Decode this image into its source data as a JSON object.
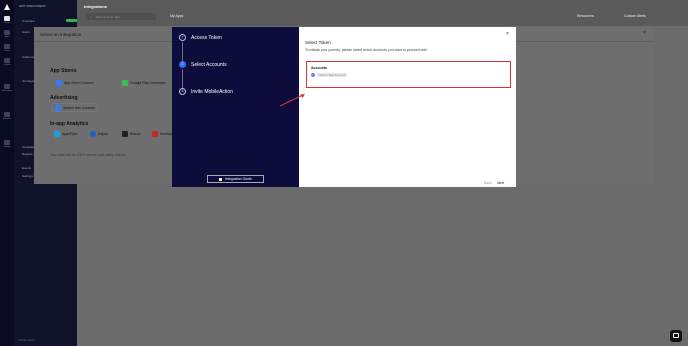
{
  "app_nav": {
    "labels": [
      "Home",
      "Apps",
      "Users",
      "Insights",
      "Messaging",
      "Analytics",
      "Settings"
    ]
  },
  "sub_nav": {
    "app_name": "APP DISCOVERY",
    "items": [
      "Overview",
      "Users",
      "Audience",
      "Journeys",
      "Campaigns",
      "Reports",
      "Events",
      "Settings"
    ],
    "footer": "MobileAction"
  },
  "topbar": {
    "title": "Integrations",
    "search_placeholder": "Search for an app",
    "my_apps": "My Apps",
    "resources": "Resources",
    "custom_alerts": "Custom Alerts"
  },
  "select_integration": {
    "title": "Select an Integration",
    "sections": {
      "app_stores": "App Stores",
      "advertising": "Advertising",
      "in_app_analytics": "In-app Analytics"
    },
    "app_store_connect": "App Store Connect",
    "google_play": "Google Play Developer",
    "search_ads_connect": "Search Ads Connect",
    "appsflyer": "AppsFlyer",
    "adjust": "Adjust",
    "branch": "Branch",
    "kochava": "Kochava",
    "safe_note": "Your data will be 100% secure and safely stored."
  },
  "wizard": {
    "steps": [
      {
        "num": "✓",
        "label": "Access Token"
      },
      {
        "num": "2",
        "label": "Select Accounts"
      },
      {
        "num": "3",
        "label": "Invite MobileAction"
      }
    ],
    "integration_guide": "Integration Guide",
    "right_title": "Select Token",
    "right_subtitle": "To initiate your journey, please select which accounts you want to proceed with.",
    "accounts_title": "Accounts",
    "account_name": "Admin Test Account",
    "back": "Back",
    "next": "Next"
  },
  "colors": {
    "wizard_bg": "#0d0c3b",
    "active_step": "#2e6fff",
    "highlight": "#d53535",
    "new_badge": "#2fb34a"
  }
}
